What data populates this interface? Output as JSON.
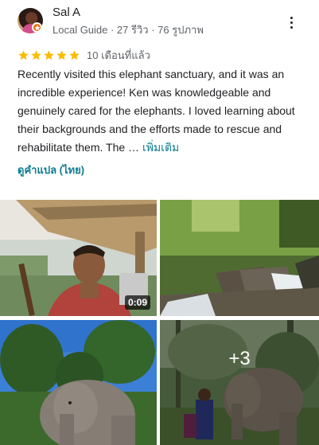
{
  "reviewer": {
    "name": "Sal A",
    "meta": "Local Guide · 27 รีวิว · 76 รูปภาพ"
  },
  "review": {
    "rating": 5,
    "star_color": "#fbbc04",
    "date": "10 เดือนที่แล้ว",
    "text": "Recently visited this elephant sanctuary, and it was an incredible experience! Ken was knowledgeable and genuinely cared for the elephants. I loved learning about their backgrounds and the efforts made to rescue and rehabilitate them. The …",
    "more_label": "เพิ่มเติม",
    "translate_label": "ดูคำแปล (ไทย)"
  },
  "photos": {
    "video_duration": "0:09",
    "more_count": "+3"
  },
  "colors": {
    "link": "#0b7c8f",
    "badge": "#e8710a"
  }
}
